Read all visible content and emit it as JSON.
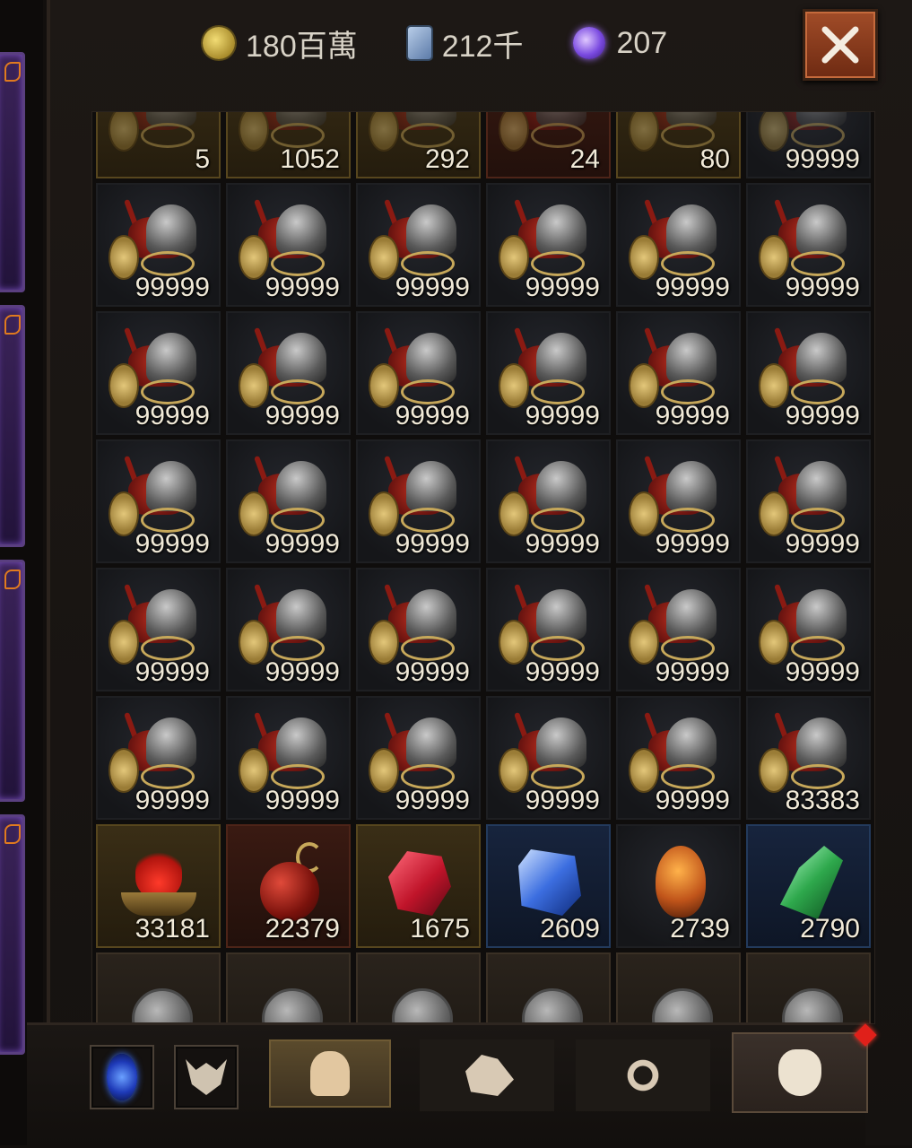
{
  "currency": {
    "gold": {
      "value": "180百萬",
      "icon": "gold-coin-icon"
    },
    "scroll": {
      "value": "212千",
      "icon": "scroll-icon"
    },
    "orb": {
      "value": "207",
      "icon": "purple-orb-icon"
    }
  },
  "close_icon": "close-icon",
  "grid": {
    "top_row": [
      {
        "qty": "5",
        "tier": "tier-gold"
      },
      {
        "qty": "1052",
        "tier": "tier-gold"
      },
      {
        "qty": "292",
        "tier": "tier-gold"
      },
      {
        "qty": "24",
        "tier": "tier-red"
      },
      {
        "qty": "80",
        "tier": "tier-gold"
      },
      {
        "qty": "99999",
        "tier": ""
      }
    ],
    "gear_rows": [
      [
        "99999",
        "99999",
        "99999",
        "99999",
        "99999",
        "99999"
      ],
      [
        "99999",
        "99999",
        "99999",
        "99999",
        "99999",
        "99999"
      ],
      [
        "99999",
        "99999",
        "99999",
        "99999",
        "99999",
        "99999"
      ],
      [
        "99999",
        "99999",
        "99999",
        "99999",
        "99999",
        "99999"
      ],
      [
        "99999",
        "99999",
        "99999",
        "99999",
        "99999",
        "83383"
      ]
    ],
    "materials": [
      {
        "qty": "33181",
        "icon": "brazier",
        "tier": "tier-gold"
      },
      {
        "qty": "22379",
        "icon": "pouch",
        "tier": "tier-red"
      },
      {
        "qty": "1675",
        "icon": "ruby",
        "tier": "tier-gold"
      },
      {
        "qty": "2609",
        "icon": "cube",
        "tier": "tier-blue"
      },
      {
        "qty": "2739",
        "icon": "egg",
        "tier": ""
      },
      {
        "qty": "2790",
        "icon": "shard",
        "tier": "tier-blue"
      }
    ],
    "bottom_row_count": 6
  },
  "tabs": [
    {
      "name": "portal-tab",
      "icon": "portal-icon"
    },
    {
      "name": "beast-tab",
      "icon": "beast-icon"
    },
    {
      "name": "equipment-tab",
      "icon": "helmet-icon",
      "state": "active"
    },
    {
      "name": "materials-tab",
      "icon": "stone-icon"
    },
    {
      "name": "essence-tab",
      "icon": "swirl-icon"
    },
    {
      "name": "bag-tab",
      "icon": "sack-icon",
      "state": "selected",
      "notification": true
    }
  ]
}
